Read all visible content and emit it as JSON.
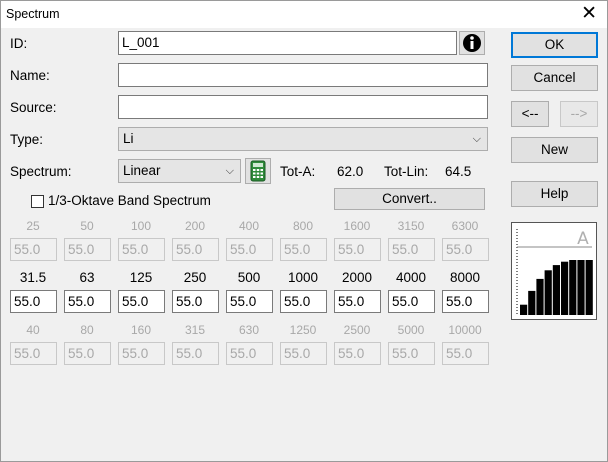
{
  "window": {
    "title": "Spectrum",
    "close_glyph": "✕"
  },
  "fields": {
    "id_label": "ID:",
    "id_value": "L_001",
    "name_label": "Name:",
    "name_value": "",
    "source_label": "Source:",
    "source_value": "",
    "type_label": "Type:",
    "type_value": "Li",
    "spectrum_label": "Spectrum:",
    "spectrum_value": "Linear"
  },
  "totals": {
    "tot_a_label": "Tot-A:",
    "tot_a_value": "62.0",
    "tot_lin_label": "Tot-Lin:",
    "tot_lin_value": "64.5"
  },
  "third_octave_checkbox": {
    "label": "1/3-Oktave Band Spectrum",
    "checked": false
  },
  "buttons": {
    "ok": "OK",
    "cancel": "Cancel",
    "prev": "<--",
    "next": "-->",
    "new": "New",
    "help": "Help",
    "convert": "Convert.."
  },
  "bands": {
    "row_upper": {
      "freqs": [
        "25",
        "50",
        "100",
        "200",
        "400",
        "800",
        "1600",
        "3150",
        "6300"
      ],
      "values": [
        "55.0",
        "55.0",
        "55.0",
        "55.0",
        "55.0",
        "55.0",
        "55.0",
        "55.0",
        "55.0"
      ]
    },
    "row_active": {
      "freqs": [
        "31.5",
        "63",
        "125",
        "250",
        "500",
        "1000",
        "2000",
        "4000",
        "8000"
      ],
      "values": [
        "55.0",
        "55.0",
        "55.0",
        "55.0",
        "55.0",
        "55.0",
        "55.0",
        "55.0",
        "55.0"
      ]
    },
    "row_lower": {
      "freqs": [
        "40",
        "80",
        "160",
        "315",
        "630",
        "1250",
        "2500",
        "5000",
        "10000"
      ],
      "values": [
        "55.0",
        "55.0",
        "55.0",
        "55.0",
        "55.0",
        "55.0",
        "55.0",
        "55.0",
        "55.0"
      ]
    }
  },
  "preview": {
    "weighting_label": "A",
    "bar_levels": [
      0.12,
      0.28,
      0.42,
      0.52,
      0.58,
      0.62,
      0.64,
      0.64,
      0.64
    ]
  },
  "icons": {
    "info": "info-icon",
    "calculator": "calculator-icon"
  },
  "colors": {
    "accent": "#0078d7",
    "calc_green": "#2e8b3a"
  }
}
